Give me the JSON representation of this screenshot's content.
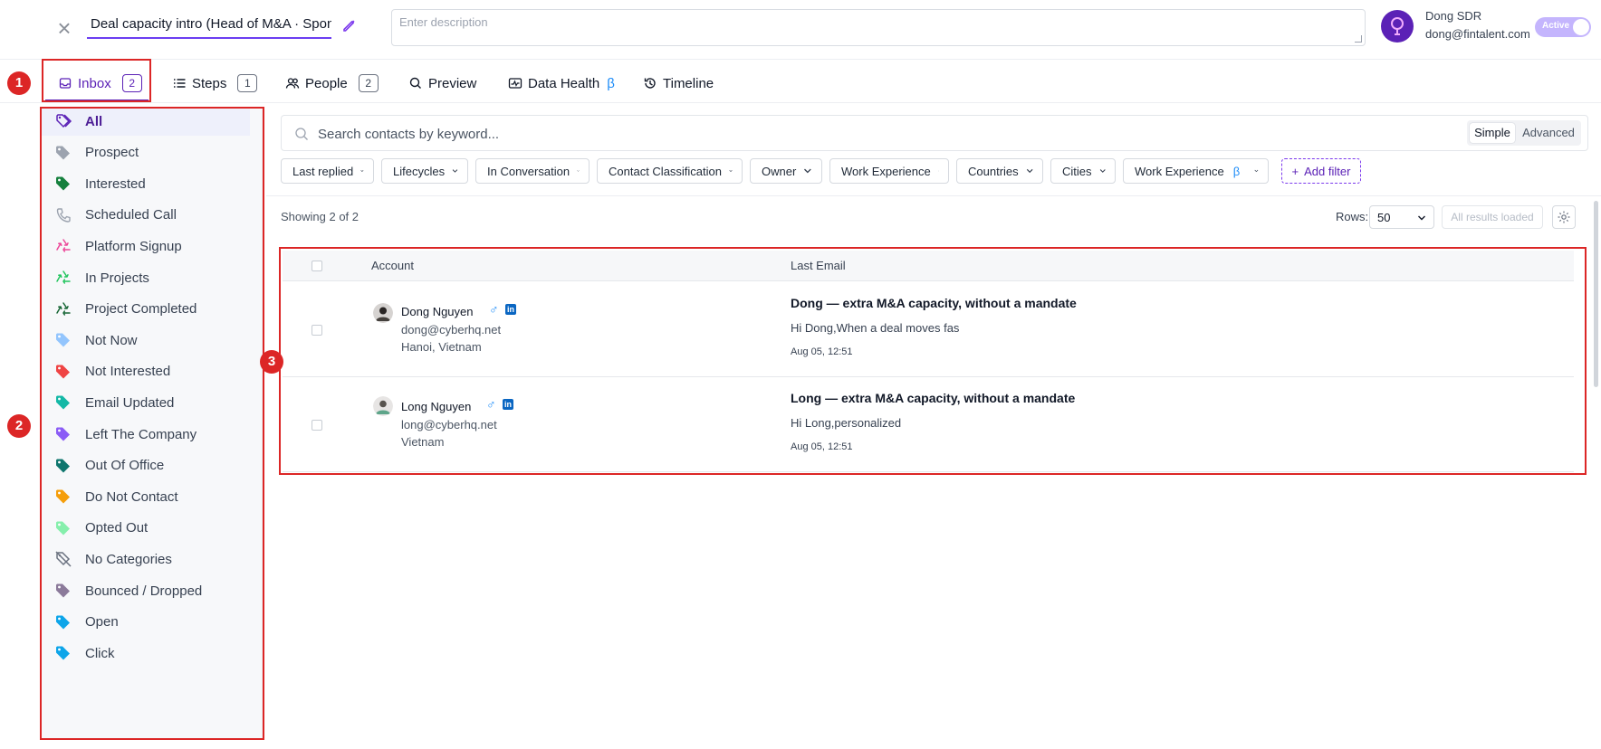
{
  "header": {
    "title": "Deal capacity intro (Head of M&A · Spons",
    "description_placeholder": "Enter description",
    "user_name": "Dong SDR",
    "user_email": "dong@fintalent.com",
    "status_toggle": "Active"
  },
  "tabs": [
    {
      "label": "Inbox",
      "count": "2"
    },
    {
      "label": "Steps",
      "count": "1"
    },
    {
      "label": "People",
      "count": "2"
    },
    {
      "label": "Preview"
    },
    {
      "label": "Data Health",
      "suffix": "β"
    },
    {
      "label": "Timeline"
    }
  ],
  "annotations": [
    "1",
    "2",
    "3"
  ],
  "sidebar": {
    "items": [
      {
        "label": "All",
        "color": "#5b21b6",
        "icon": "tags-icon"
      },
      {
        "label": "Prospect",
        "color": "#9ca3af",
        "icon": "tag-icon"
      },
      {
        "label": "Interested",
        "color": "#15803d",
        "icon": "tag-icon"
      },
      {
        "label": "Scheduled Call",
        "color": "#9ca3af",
        "icon": "phone-icon"
      },
      {
        "label": "Platform Signup",
        "color": "#ec4899",
        "icon": "recycle-icon"
      },
      {
        "label": "In Projects",
        "color": "#22c55e",
        "icon": "recycle-icon"
      },
      {
        "label": "Project Completed",
        "color": "#166534",
        "icon": "recycle-icon"
      },
      {
        "label": "Not Now",
        "color": "#93c5fd",
        "icon": "tag-icon"
      },
      {
        "label": "Not Interested",
        "color": "#ef4444",
        "icon": "tag-icon"
      },
      {
        "label": "Email Updated",
        "color": "#14b8a6",
        "icon": "tag-icon"
      },
      {
        "label": "Left The Company",
        "color": "#8b5cf6",
        "icon": "tag-icon"
      },
      {
        "label": "Out Of Office",
        "color": "#0f766e",
        "icon": "tag-icon"
      },
      {
        "label": "Do Not Contact",
        "color": "#f59e0b",
        "icon": "tag-icon"
      },
      {
        "label": "Opted Out",
        "color": "#86efac",
        "icon": "tag-icon"
      },
      {
        "label": "No Categories",
        "color": "#6b7280",
        "icon": "tag-off-icon"
      },
      {
        "label": "Bounced / Dropped",
        "color": "#8b7a9a",
        "icon": "tag-icon"
      },
      {
        "label": "Open",
        "color": "#0ea5e9",
        "icon": "tag-icon"
      },
      {
        "label": "Click",
        "color": "#0ea5e9",
        "icon": "tag-icon"
      }
    ]
  },
  "search": {
    "placeholder": "Search contacts by keyword...",
    "mode_simple": "Simple",
    "mode_advanced": "Advanced"
  },
  "filters": [
    "Last replied",
    "Lifecycles",
    "In Conversation",
    "Contact Classification",
    "Owner",
    "Work Experience",
    "Countries",
    "Cities",
    "Work Experience"
  ],
  "filter_beta_suffix": "β",
  "add_filter_label": "Add filter",
  "results": {
    "showing": "Showing 2 of 2",
    "rows_label": "Rows:",
    "rows_value": "50",
    "all_loaded": "All results loaded"
  },
  "table": {
    "columns": [
      "Account",
      "Last Email"
    ],
    "rows": [
      {
        "name": "Dong Nguyen",
        "email": "dong@cyberhq.net",
        "location": "Hanoi, Vietnam",
        "subject": "Dong — extra M&A capacity, without a mandate",
        "preview": "Hi Dong,When a deal moves fas",
        "date": "Aug 05, 12:51"
      },
      {
        "name": "Long Nguyen",
        "email": "long@cyberhq.net",
        "location": "Vietnam",
        "subject": "Long — extra M&A capacity, without a mandate",
        "preview": "Hi Long,personalized",
        "date": "Aug 05, 12:51"
      }
    ]
  },
  "colors": {
    "accent": "#5b21b6",
    "annotation": "#dc2626",
    "link_blue": "#1d8cf8"
  }
}
